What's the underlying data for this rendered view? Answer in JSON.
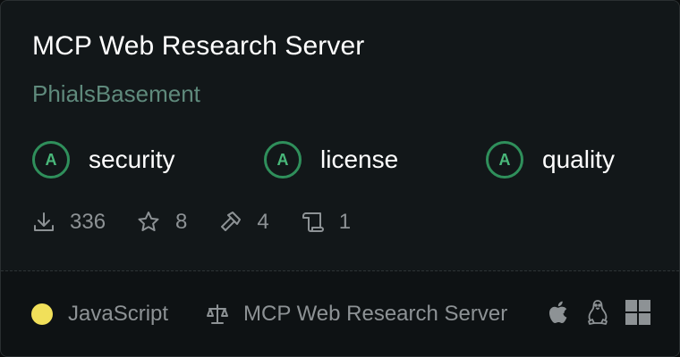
{
  "server": {
    "title": "MCP Web Research Server",
    "author": "PhialsBasement"
  },
  "grades": [
    {
      "letter": "A",
      "label": "security"
    },
    {
      "letter": "A",
      "label": "license"
    },
    {
      "letter": "A",
      "label": "quality"
    }
  ],
  "stats": {
    "downloads": "336",
    "stars": "8",
    "tools": "4",
    "scrolls": "1"
  },
  "footer": {
    "language": "JavaScript",
    "language_color": "#f1e05a",
    "license_text": "MCP Web Research Server",
    "platforms": [
      "apple-icon",
      "linux-icon",
      "windows-icon"
    ]
  },
  "colors": {
    "grade_accent": "#2f8f5b",
    "author": "#5f8a7c"
  }
}
